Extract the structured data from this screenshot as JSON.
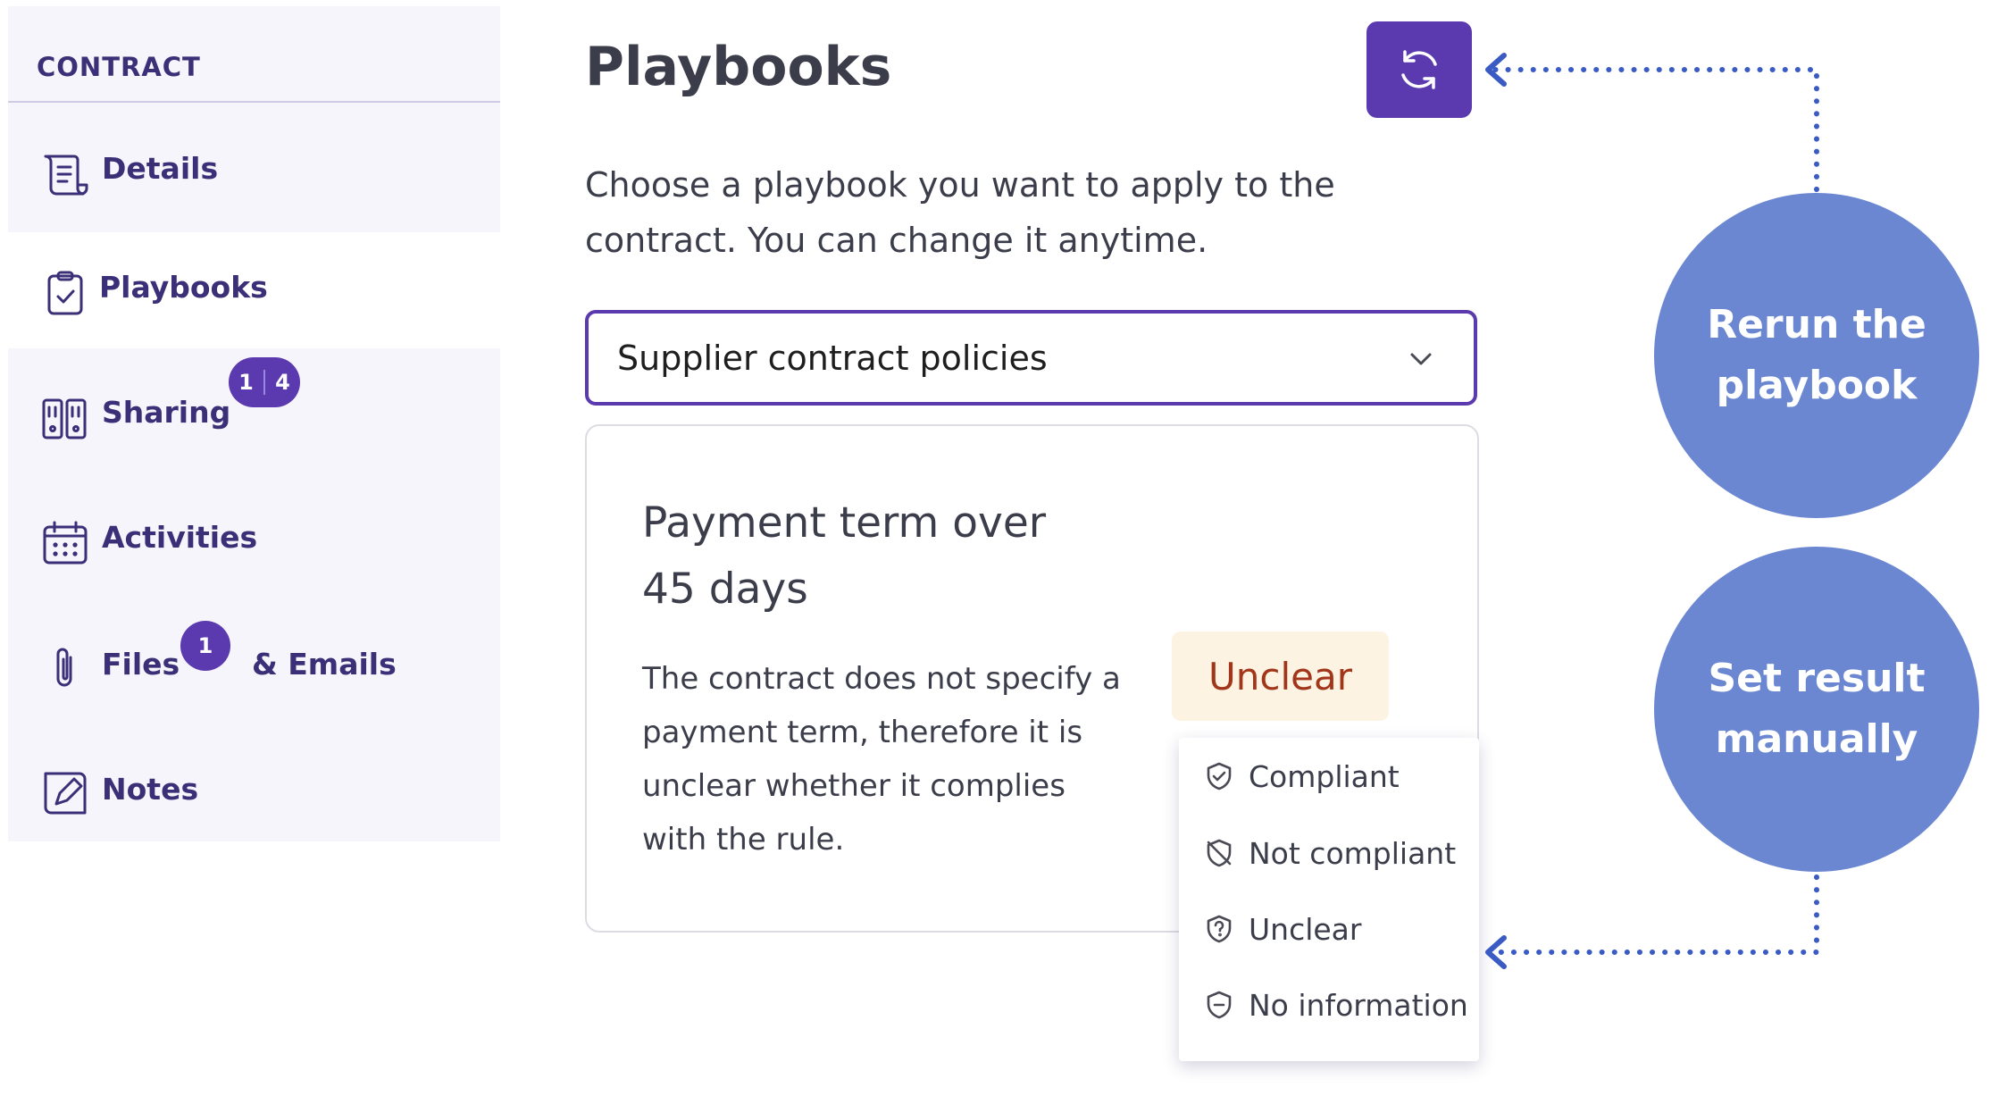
{
  "sidebar": {
    "header": "CONTRACT",
    "items": [
      {
        "label": "Details"
      },
      {
        "label": "Playbooks"
      },
      {
        "label": "Sharing",
        "badge_a": "1",
        "badge_b": "4"
      },
      {
        "label": "Activities"
      },
      {
        "label": "Files",
        "label_suffix": "& Emails",
        "badge": "1"
      },
      {
        "label": "Notes"
      }
    ]
  },
  "main": {
    "title": "Playbooks",
    "description": "Choose a playbook you want to apply to the contract. You can change it anytime.",
    "playbook_select": {
      "value": "Supplier contract policies"
    },
    "rule": {
      "title": "Payment term over 45 days",
      "text": "The contract does not specify a payment term, therefore it is unclear whether it complies with the rule.",
      "status": "Unclear"
    },
    "result_options": [
      "Compliant",
      "Not compliant",
      "Unclear",
      "No information"
    ]
  },
  "annotations": {
    "rerun": "Rerun the playbook",
    "set_result": "Set result manually"
  },
  "colors": {
    "accent": "#5b3ab0",
    "sidebar_text": "#3b2f78",
    "annotation": "#6b87d2",
    "connector": "#3a5bc4",
    "status_bg": "#fdf3e2",
    "status_text": "#a2361a"
  }
}
